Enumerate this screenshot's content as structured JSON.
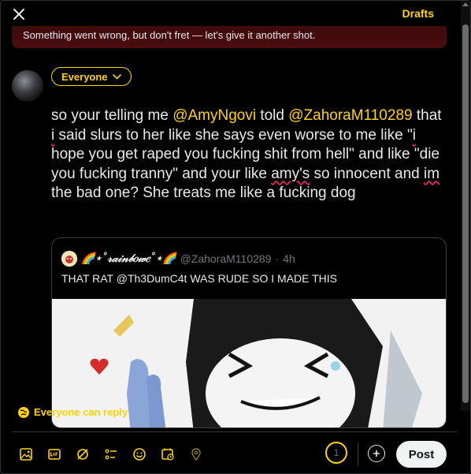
{
  "header": {
    "drafts_label": "Drafts"
  },
  "error": {
    "message": "Something went wrong, but don't fret — let's give it another shot."
  },
  "composer": {
    "audience_label": "Everyone",
    "text": {
      "p1": "so your telling me ",
      "mention1": "@AmyNgovi",
      "p2": " told ",
      "mention2": "@ZahoraM110289",
      "p3": " that ",
      "w_i1": "i",
      "p4": " said slurs to her like she says even worse to me like \"",
      "w_i2": "i",
      "p5": " hope you get raped you fucking shit from hell\" and like \"die you fucking tranny\" and your like ",
      "w_amys": "amy's",
      "p6": " so innocent and ",
      "w_im": "im",
      "p7": " the bad one? She treats me like a fucking dog"
    }
  },
  "quote": {
    "display_name": "🌈⋆˚𝓇𝒶𝒾𝓃𝒷𝑜𝓌𝑒˚⋆🌈",
    "handle": "@ZahoraM110289",
    "separator": "·",
    "time": "4h",
    "text": "THAT RAT @Th3DumC4t  WAS RUDE SO I MADE THIS"
  },
  "reply_setting": {
    "label": "Everyone can reply"
  },
  "toolbar": {
    "icons": [
      "image-icon",
      "gif-icon",
      "grok-icon",
      "poll-icon",
      "emoji-icon",
      "schedule-icon",
      "location-icon"
    ],
    "counter": "1",
    "post_label": "Post"
  },
  "colors": {
    "accent": "#ffd400",
    "background": "#000000",
    "text": "#e7e9ea",
    "error_bg": "#4a0b0e"
  }
}
